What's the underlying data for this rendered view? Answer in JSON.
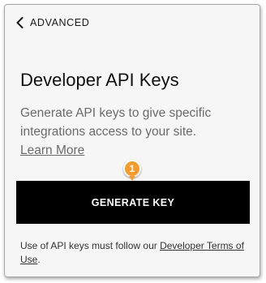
{
  "nav": {
    "back_label": "ADVANCED",
    "back_icon": "chevron-left-icon"
  },
  "page": {
    "title": "Developer API Keys",
    "description_text": "Generate API keys to give specific integrations access to your site.",
    "learn_more_label": "Learn More"
  },
  "callout": {
    "step_number": "1",
    "color": "#f39c2b"
  },
  "actions": {
    "generate_label": "GENERATE KEY",
    "button_color": "#000000"
  },
  "footer": {
    "notice_text": "Use of API keys must follow our",
    "terms_link_label": "Developer Terms of Use",
    "notice_end": "."
  }
}
